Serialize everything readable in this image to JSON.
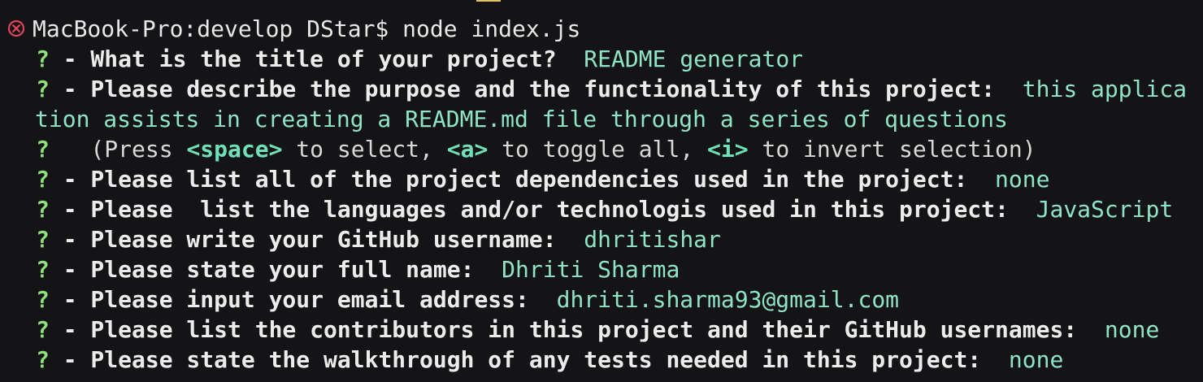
{
  "terminal": {
    "prompt": "MacBook-Pro:develop DStar$ node index.js",
    "colors": {
      "background": "#141416",
      "question_mark": "#8ee07c",
      "answer": "#8fe3c6",
      "error_icon": "#e0445a"
    },
    "lines": [
      {
        "mark": "?",
        "question": " - What is the title of your project? ",
        "answer": " README generator"
      },
      {
        "mark": "?",
        "question": " - Please describe the purpose and the functionality of this project: ",
        "answer": " this applica"
      },
      {
        "continuation": "tion assists in creating a README.md file through a series of questions"
      },
      {
        "mark": "?",
        "hint_pre": "   (Press ",
        "key1": "<space>",
        "hint_mid1": " to select, ",
        "key2": "<a>",
        "hint_mid2": " to toggle all, ",
        "key3": "<i>",
        "hint_post": " to invert selection)"
      },
      {
        "mark": "?",
        "question": " - Please list all of the project dependencies used in the project: ",
        "answer": " none"
      },
      {
        "mark": "?",
        "question": " - Please  list the languages and/or technologis used in this project: ",
        "answer": " JavaScript"
      },
      {
        "mark": "?",
        "question": " - Please write your GitHub username: ",
        "answer": " dhritishar"
      },
      {
        "mark": "?",
        "question": " - Please state your full name: ",
        "answer": " Dhriti Sharma"
      },
      {
        "mark": "?",
        "question": " - Please input your email address: ",
        "answer": " dhriti.sharma93@gmail.com"
      },
      {
        "mark": "?",
        "question": " - Please list the contributors in this project and their GitHub usernames: ",
        "answer": " none"
      },
      {
        "mark": "?",
        "question": " - Please state the walkthrough of any tests needed in this project: ",
        "answer": " none"
      }
    ]
  }
}
